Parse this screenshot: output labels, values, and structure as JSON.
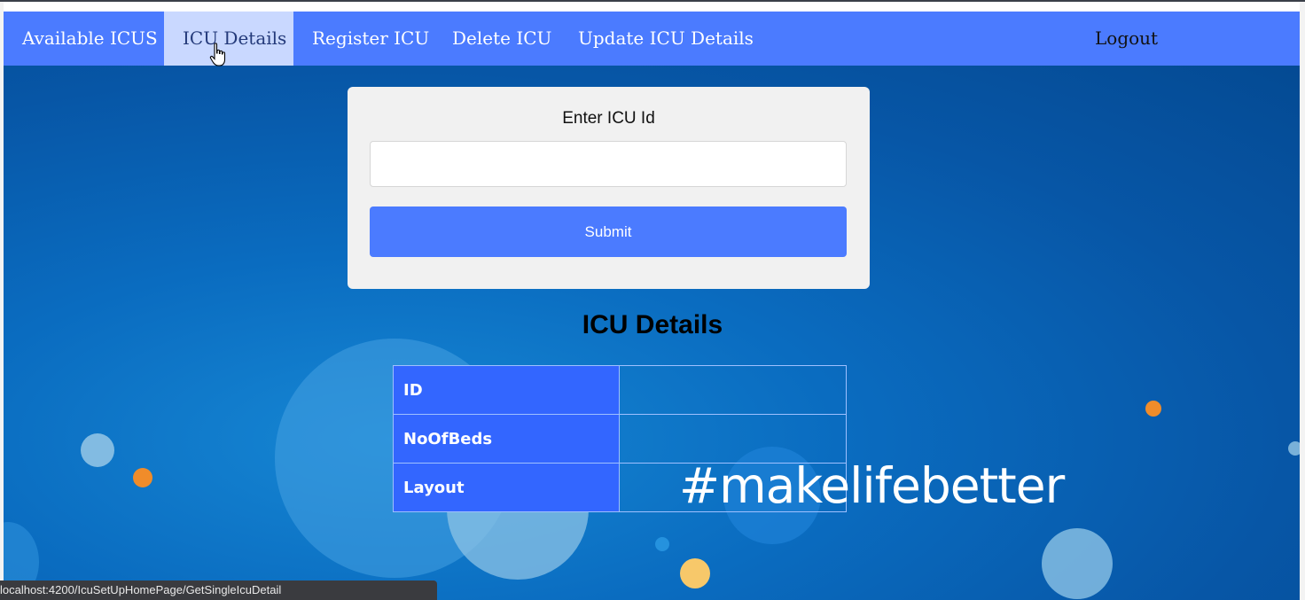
{
  "nav": {
    "items": [
      {
        "label": "Available ICUS"
      },
      {
        "label": "ICU Details"
      },
      {
        "label": "Register ICU"
      },
      {
        "label": "Delete ICU"
      },
      {
        "label": "Update ICU Details"
      }
    ],
    "logout_label": "Logout",
    "active_item": "ICU Details"
  },
  "form": {
    "title": "Enter ICU Id",
    "input_value": "",
    "input_placeholder": "",
    "submit_label": "Submit"
  },
  "details": {
    "heading": "ICU Details",
    "rows": [
      {
        "key": "ID",
        "value": ""
      },
      {
        "key": "NoOfBeds",
        "value": ""
      },
      {
        "key": "Layout",
        "value": ""
      }
    ]
  },
  "hero": {
    "tagline": "#makelifebetter"
  },
  "status_bar": {
    "url": "localhost:4200/IcuSetUpHomePage/GetSingleIcuDetail"
  },
  "colors": {
    "nav_bg": "#4b7bff",
    "nav_active_bg": "#c9d8ff",
    "button_bg": "#4b7bff",
    "table_key_bg": "#3366ff",
    "hero_bg": "#0756a6"
  }
}
